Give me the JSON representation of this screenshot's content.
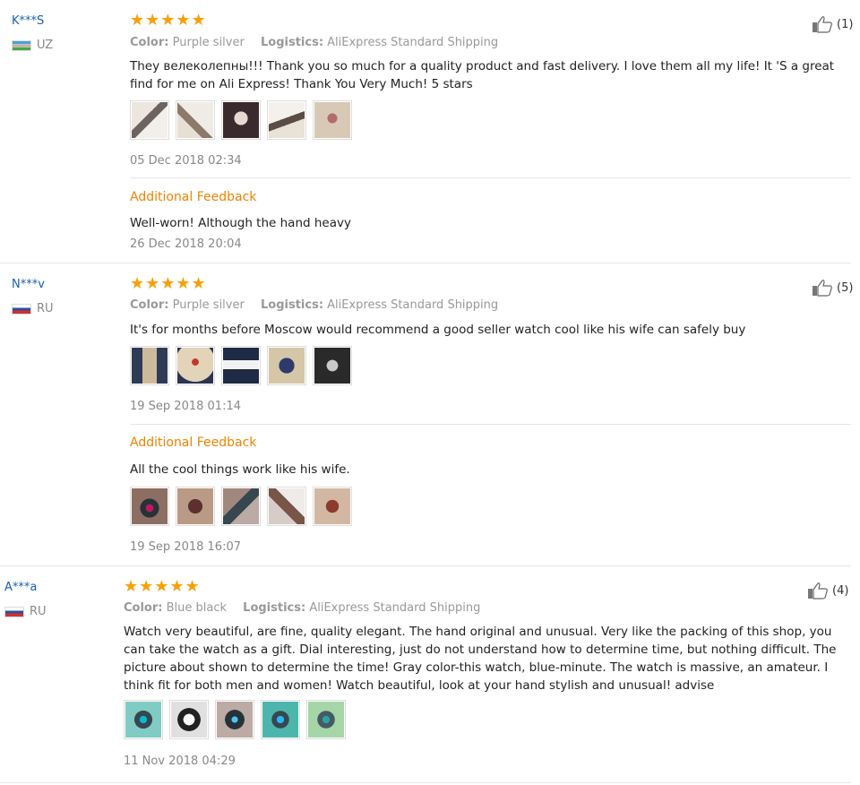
{
  "icons": {
    "rating": "star-icon",
    "helpful": "thumbs-up-icon"
  },
  "colors": {
    "star": "#f7a007",
    "user": "#1a5fb4",
    "additional_feedback": "#f08300"
  },
  "reviews": [
    {
      "user": "K***S",
      "country": "UZ",
      "rating": 5,
      "stars": "★★★★★",
      "color_label": "Color:",
      "color_value": "Purple silver",
      "logistics_label": "Logistics:",
      "logistics_value": "AliExpress Standard Shipping",
      "helpful": "(1)",
      "text": "They велеколепны!!! Thank you so much for a quality product and fast delivery. I love them all my life! It 'S a great find for me on Ali Express! Thank You Very Much! 5 stars",
      "date": "05 Dec 2018 02:34",
      "additional": {
        "label": "Additional Feedback",
        "text": "Well-worn! Although the hand heavy",
        "date": "26 Dec 2018 20:04"
      }
    },
    {
      "user": "N***v",
      "country": "RU",
      "rating": 5,
      "stars": "★★★★★",
      "color_label": "Color:",
      "color_value": "Purple silver",
      "logistics_label": "Logistics:",
      "logistics_value": "AliExpress Standard Shipping",
      "helpful": "(5)",
      "text": "It's for months before Moscow would recommend a good seller watch cool like his wife can safely buy",
      "date": "19 Sep 2018 01:14",
      "additional": {
        "label": "Additional Feedback",
        "text": "All the cool things work like his wife.",
        "date": "19 Sep 2018 16:07"
      }
    },
    {
      "user": "A***a",
      "country": "RU",
      "rating": 5,
      "stars": "★★★★★",
      "color_label": "Color:",
      "color_value": "Blue black",
      "logistics_label": "Logistics:",
      "logistics_value": "AliExpress Standard Shipping",
      "helpful": "(4)",
      "text": "Watch very beautiful, are fine, quality elegant. The hand original and unusual. Very like the packing of this shop, you can take the watch as a gift. Dial interesting, just do not understand how to determine time, but nothing difficult. The picture about shown to determine the time! Gray color-this watch, blue-minute. The watch is massive, an amateur. I think fit for both men and women! Watch beautiful, look at your hand stylish and unusual! advise",
      "date": "11 Nov 2018 04:29"
    }
  ]
}
